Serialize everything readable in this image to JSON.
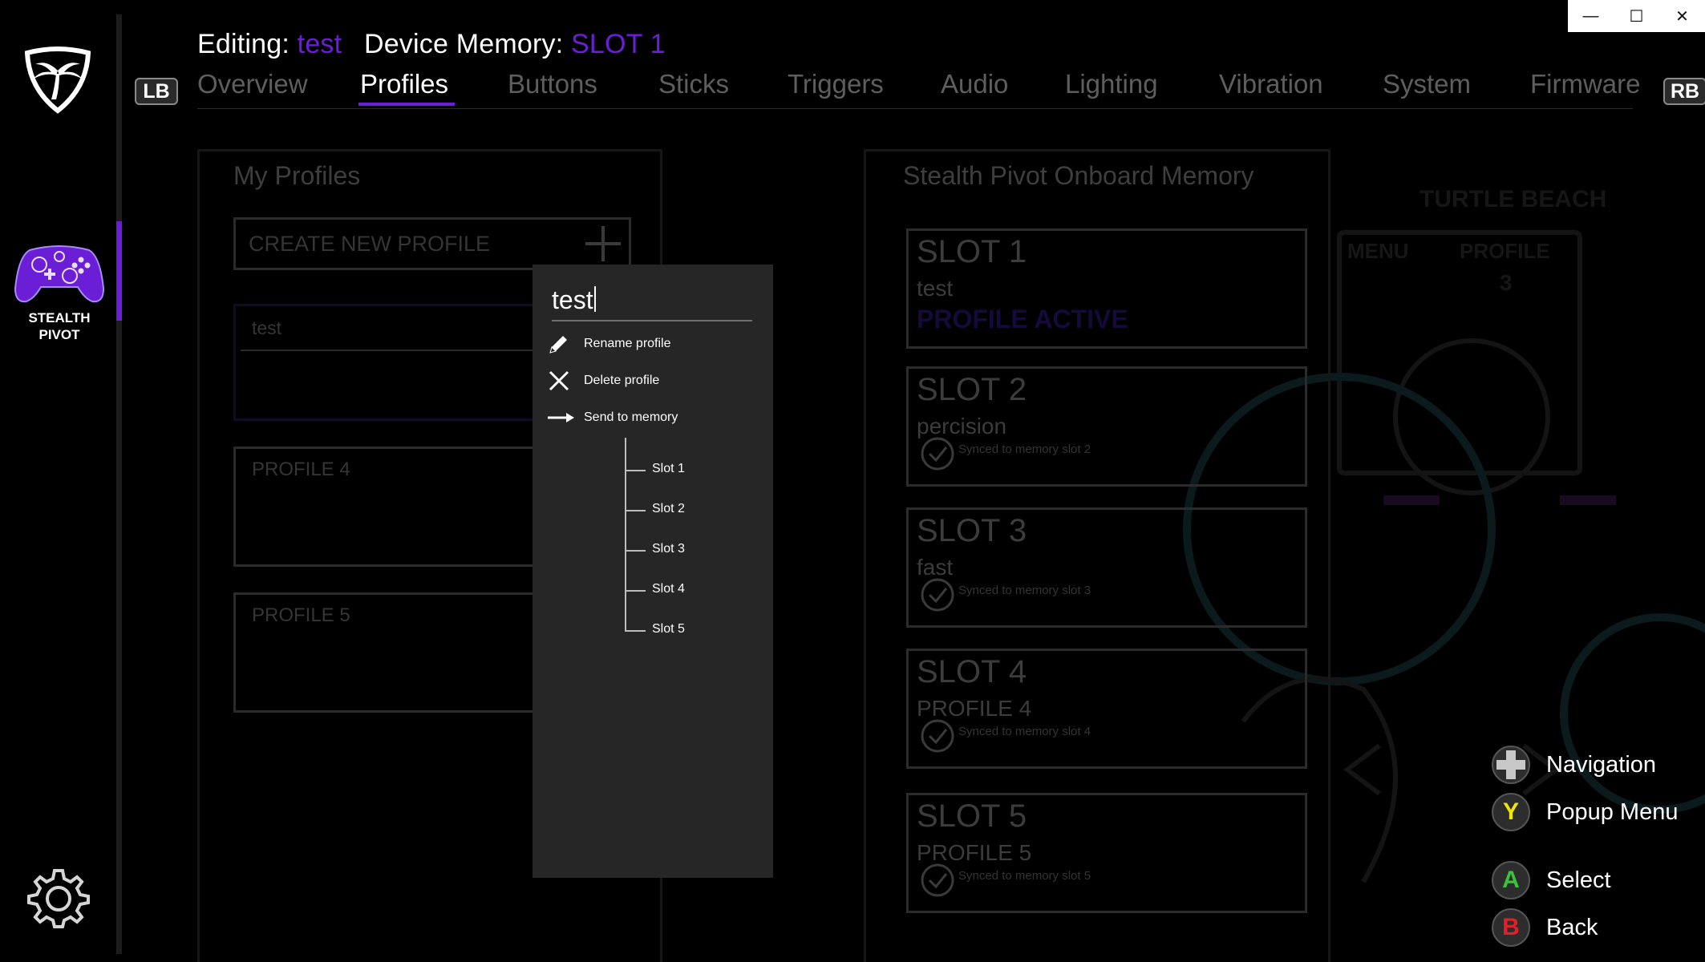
{
  "window": {
    "minimize_glyph": "—",
    "maximize_glyph": "☐",
    "close_glyph": "✕"
  },
  "rail": {
    "device_label_line1": "STEALTH",
    "device_label_line2": "PIVOT"
  },
  "header": {
    "editing_prefix": "Editing:",
    "editing_profile": "test",
    "memory_prefix": "Device Memory:",
    "memory_slot": "SLOT 1",
    "lb": "LB",
    "rb": "RB"
  },
  "tabs": [
    {
      "label": "Overview"
    },
    {
      "label": "Profiles"
    },
    {
      "label": "Buttons"
    },
    {
      "label": "Sticks"
    },
    {
      "label": "Triggers"
    },
    {
      "label": "Audio"
    },
    {
      "label": "Lighting"
    },
    {
      "label": "Vibration"
    },
    {
      "label": "System"
    },
    {
      "label": "Firmware"
    }
  ],
  "active_tab": "Profiles",
  "my_profiles": {
    "title": "My Profiles",
    "create_label": "CREATE NEW PROFILE",
    "profiles": [
      "test",
      "PROFILE 4",
      "PROFILE 5"
    ]
  },
  "memory": {
    "title": "Stealth Pivot Onboard Memory",
    "slots": [
      {
        "title": "SLOT 1",
        "profile": "test",
        "status": "PROFILE ACTIVE"
      },
      {
        "title": "SLOT 2",
        "profile": "percision",
        "status": "Synced to memory slot 2"
      },
      {
        "title": "SLOT 3",
        "profile": "fast",
        "status": "Synced to memory slot 3"
      },
      {
        "title": "SLOT 4",
        "profile": "PROFILE 4",
        "status": "Synced to memory slot 4"
      },
      {
        "title": "SLOT 5",
        "profile": "PROFILE 5",
        "status": "Synced to memory slot 5"
      }
    ]
  },
  "popup": {
    "name_value": "test",
    "rename": "Rename profile",
    "delete": "Delete profile",
    "send": "Send to memory",
    "slots": [
      "Slot 1",
      "Slot 2",
      "Slot 3",
      "Slot 4",
      "Slot 5"
    ]
  },
  "background": {
    "brand": "TURTLE BEACH",
    "menu_label": "MENU",
    "profile_label": "PROFILE",
    "profile_number": "3"
  },
  "legend": [
    {
      "button": "",
      "label": "Navigation",
      "color": "#bdbdbd"
    },
    {
      "button": "Y",
      "label": "Popup Menu",
      "color": "#f2e600"
    },
    {
      "button": "A",
      "label": "Select",
      "color": "#3cc23c"
    },
    {
      "button": "B",
      "label": "Back",
      "color": "#e0202a"
    }
  ],
  "colors": {
    "accent": "#6a1fd6",
    "background": "#000000",
    "popup": "#262626"
  }
}
